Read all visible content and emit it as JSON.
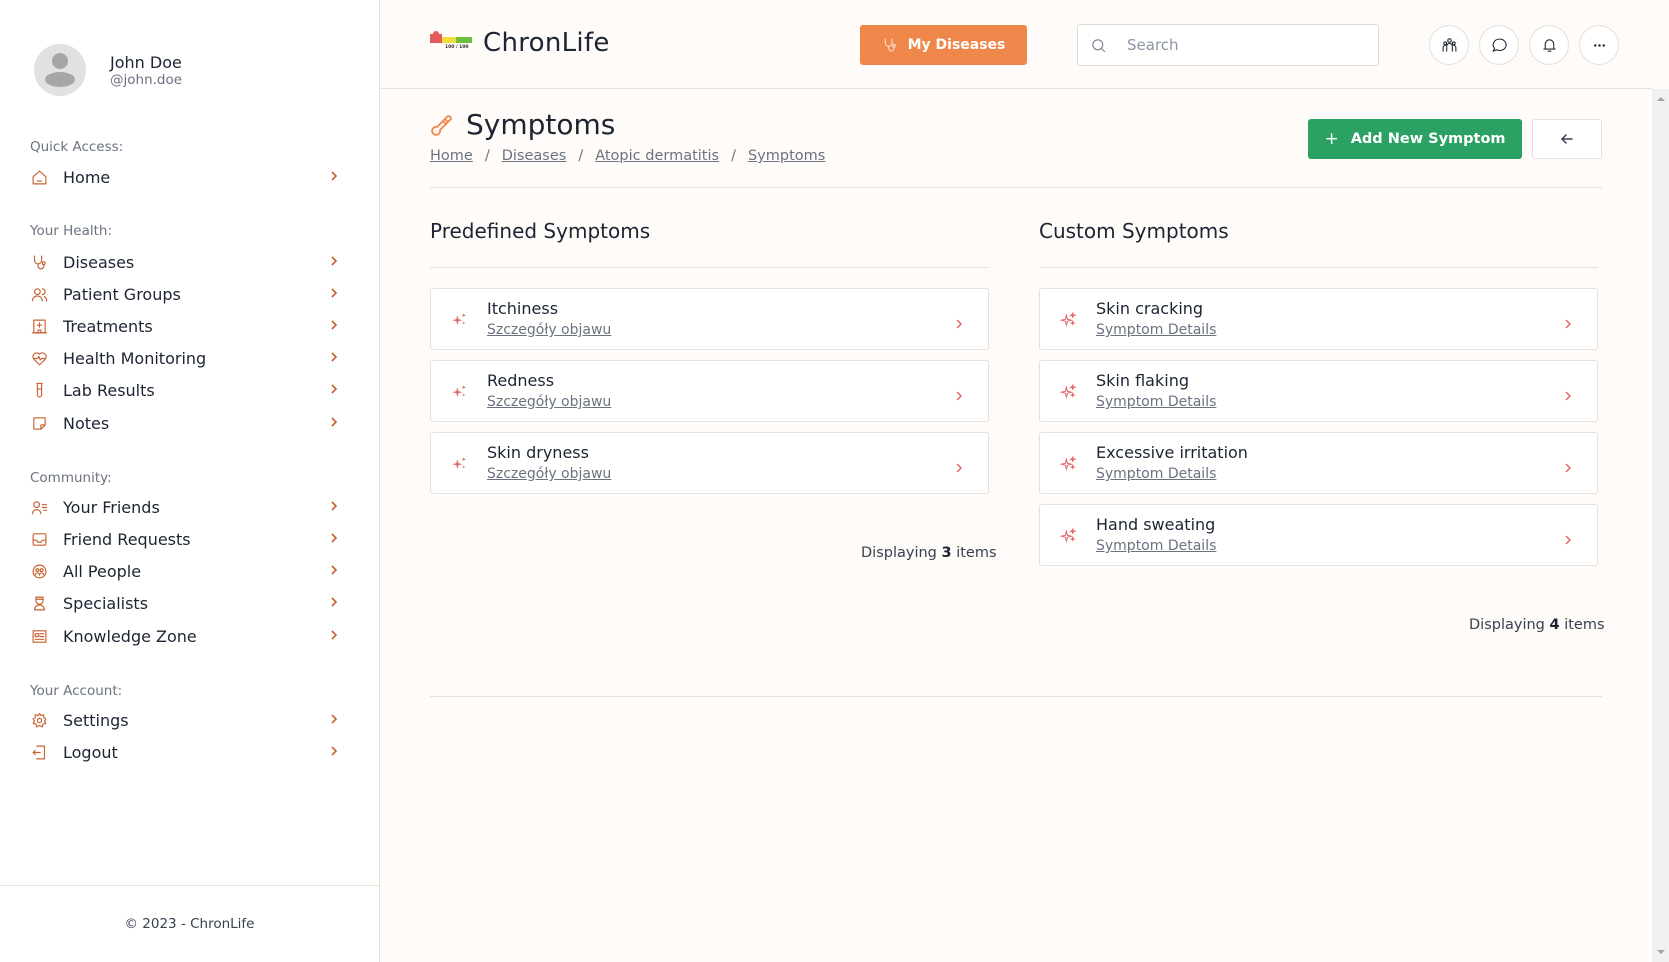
{
  "user": {
    "name": "John Doe",
    "handle": "@john.doe"
  },
  "sidebar": {
    "sections": [
      {
        "label": "Quick Access:",
        "items": [
          {
            "label": "Home",
            "icon": "home-icon"
          }
        ]
      },
      {
        "label": "Your Health:",
        "items": [
          {
            "label": "Diseases",
            "icon": "stethoscope-icon"
          },
          {
            "label": "Patient Groups",
            "icon": "users-icon"
          },
          {
            "label": "Treatments",
            "icon": "hospital-icon"
          },
          {
            "label": "Health Monitoring",
            "icon": "heart-pulse-icon"
          },
          {
            "label": "Lab Results",
            "icon": "test-tube-icon"
          },
          {
            "label": "Notes",
            "icon": "note-icon"
          }
        ]
      },
      {
        "label": "Community:",
        "items": [
          {
            "label": "Your Friends",
            "icon": "user-list-icon"
          },
          {
            "label": "Friend Requests",
            "icon": "inbox-icon"
          },
          {
            "label": "All People",
            "icon": "globe-people-icon"
          },
          {
            "label": "Specialists",
            "icon": "doctor-icon"
          },
          {
            "label": "Knowledge Zone",
            "icon": "newspaper-icon"
          }
        ]
      },
      {
        "label": "Your Account:",
        "items": [
          {
            "label": "Settings",
            "icon": "gear-icon"
          },
          {
            "label": "Logout",
            "icon": "logout-icon"
          }
        ]
      }
    ],
    "footer": "© 2023 - ChronLife"
  },
  "header": {
    "app_name": "ChronLife",
    "logo_score": "100 / 100",
    "my_diseases_label": "My Diseases",
    "search_placeholder": "Search",
    "search_value": "",
    "icon_buttons": [
      "community-icon",
      "chat-icon",
      "bell-icon",
      "more-icon"
    ]
  },
  "page": {
    "title": "Symptoms",
    "breadcrumb": [
      "Home",
      "Diseases",
      "Atopic dermatitis",
      "Symptoms"
    ],
    "add_button_label": "Add New Symptom",
    "back_button_icon": "arrow-left-icon"
  },
  "predefined": {
    "title": "Predefined Symptoms",
    "items": [
      {
        "name": "Itchiness",
        "link": "Szczegóły objawu"
      },
      {
        "name": "Redness",
        "link": "Szczegóły objawu"
      },
      {
        "name": "Skin dryness",
        "link": "Szczegóły objawu"
      }
    ],
    "count_prefix": "Displaying",
    "count": "3",
    "count_suffix": "items"
  },
  "custom": {
    "title": "Custom Symptoms",
    "items": [
      {
        "name": "Skin cracking",
        "link": "Symptom Details"
      },
      {
        "name": "Skin flaking",
        "link": "Symptom Details"
      },
      {
        "name": "Excessive irritation",
        "link": "Symptom Details"
      },
      {
        "name": "Hand sweating",
        "link": "Symptom Details"
      }
    ],
    "count_prefix": "Displaying",
    "count": "4",
    "count_suffix": "items"
  },
  "colors": {
    "accent_orange": "#f0874a",
    "icon_orange": "#c8602f",
    "primary_green": "#2ba163",
    "sparkle_red": "#e46b6b",
    "background": "#fefbf8"
  }
}
